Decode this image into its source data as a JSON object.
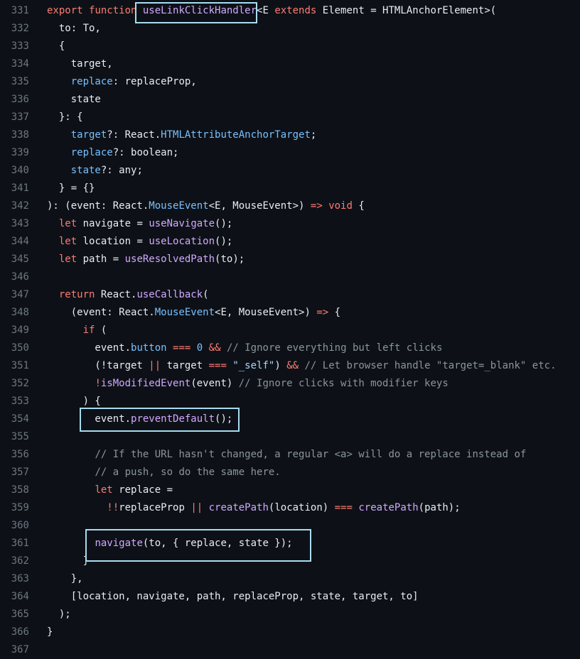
{
  "colors": {
    "background": "#0d1117",
    "keyword": "#ff7b72",
    "function": "#d2a8ff",
    "property": "#79c0ff",
    "string": "#a5d6ff",
    "comment": "#8b949e",
    "plain": "#e6edf3",
    "line_number": "#6e7681",
    "highlight_border": "#a7dcf0"
  },
  "lines": [
    {
      "n": "331",
      "tokens": [
        [
          "kw",
          "export "
        ],
        [
          "kw",
          "function "
        ],
        [
          "fn",
          "useLinkClickHandler"
        ],
        [
          "pl",
          "<E "
        ],
        [
          "kw",
          "extends "
        ],
        [
          "pl",
          "Element = HTMLAnchorElement>("
        ]
      ]
    },
    {
      "n": "332",
      "tokens": [
        [
          "pl",
          "  to: To,"
        ]
      ]
    },
    {
      "n": "333",
      "tokens": [
        [
          "pl",
          "  {"
        ]
      ]
    },
    {
      "n": "334",
      "tokens": [
        [
          "pl",
          "    target,"
        ]
      ]
    },
    {
      "n": "335",
      "tokens": [
        [
          "pl",
          "    "
        ],
        [
          "prop",
          "replace"
        ],
        [
          "pl",
          ": replaceProp,"
        ]
      ]
    },
    {
      "n": "336",
      "tokens": [
        [
          "pl",
          "    state"
        ]
      ]
    },
    {
      "n": "337",
      "tokens": [
        [
          "pl",
          "  }: {"
        ]
      ]
    },
    {
      "n": "338",
      "tokens": [
        [
          "pl",
          "    "
        ],
        [
          "prop",
          "target"
        ],
        [
          "pl",
          "?: React."
        ],
        [
          "prop",
          "HTMLAttributeAnchorTarget"
        ],
        [
          "pl",
          ";"
        ]
      ]
    },
    {
      "n": "339",
      "tokens": [
        [
          "pl",
          "    "
        ],
        [
          "prop",
          "replace"
        ],
        [
          "pl",
          "?: boolean;"
        ]
      ]
    },
    {
      "n": "340",
      "tokens": [
        [
          "pl",
          "    "
        ],
        [
          "prop",
          "state"
        ],
        [
          "pl",
          "?: any;"
        ]
      ]
    },
    {
      "n": "341",
      "tokens": [
        [
          "pl",
          "  } = {}"
        ]
      ]
    },
    {
      "n": "342",
      "tokens": [
        [
          "pl",
          "): (event: React."
        ],
        [
          "prop",
          "MouseEvent"
        ],
        [
          "pl",
          "<E, MouseEvent>) "
        ],
        [
          "op",
          "=>"
        ],
        [
          "pl",
          " "
        ],
        [
          "kw",
          "void"
        ],
        [
          "pl",
          " {"
        ]
      ]
    },
    {
      "n": "343",
      "tokens": [
        [
          "pl",
          "  "
        ],
        [
          "kw",
          "let"
        ],
        [
          "pl",
          " navigate = "
        ],
        [
          "fn",
          "useNavigate"
        ],
        [
          "pl",
          "();"
        ]
      ]
    },
    {
      "n": "344",
      "tokens": [
        [
          "pl",
          "  "
        ],
        [
          "kw",
          "let"
        ],
        [
          "pl",
          " location = "
        ],
        [
          "fn",
          "useLocation"
        ],
        [
          "pl",
          "();"
        ]
      ]
    },
    {
      "n": "345",
      "tokens": [
        [
          "pl",
          "  "
        ],
        [
          "kw",
          "let"
        ],
        [
          "pl",
          " path = "
        ],
        [
          "fn",
          "useResolvedPath"
        ],
        [
          "pl",
          "(to);"
        ]
      ]
    },
    {
      "n": "346",
      "tokens": []
    },
    {
      "n": "347",
      "tokens": [
        [
          "pl",
          "  "
        ],
        [
          "kw",
          "return"
        ],
        [
          "pl",
          " React."
        ],
        [
          "fn",
          "useCallback"
        ],
        [
          "pl",
          "("
        ]
      ]
    },
    {
      "n": "348",
      "tokens": [
        [
          "pl",
          "    (event: React."
        ],
        [
          "prop",
          "MouseEvent"
        ],
        [
          "pl",
          "<E, MouseEvent>) "
        ],
        [
          "op",
          "=>"
        ],
        [
          "pl",
          " {"
        ]
      ]
    },
    {
      "n": "349",
      "tokens": [
        [
          "pl",
          "      "
        ],
        [
          "kw",
          "if"
        ],
        [
          "pl",
          " ("
        ]
      ]
    },
    {
      "n": "350",
      "tokens": [
        [
          "pl",
          "        event."
        ],
        [
          "prop",
          "button"
        ],
        [
          "pl",
          " "
        ],
        [
          "op",
          "==="
        ],
        [
          "pl",
          " "
        ],
        [
          "num",
          "0"
        ],
        [
          "pl",
          " "
        ],
        [
          "op",
          "&&"
        ],
        [
          "pl",
          " "
        ],
        [
          "cm",
          "// Ignore everything but left clicks"
        ]
      ]
    },
    {
      "n": "351",
      "tokens": [
        [
          "pl",
          "        (!target "
        ],
        [
          "op",
          "||"
        ],
        [
          "pl",
          " target "
        ],
        [
          "op",
          "==="
        ],
        [
          "pl",
          " "
        ],
        [
          "str",
          "\"_self\""
        ],
        [
          "pl",
          ") "
        ],
        [
          "op",
          "&&"
        ],
        [
          "pl",
          " "
        ],
        [
          "cm",
          "// Let browser handle \"target=_blank\" etc."
        ]
      ]
    },
    {
      "n": "352",
      "tokens": [
        [
          "pl",
          "        "
        ],
        [
          "op",
          "!"
        ],
        [
          "fn",
          "isModifiedEvent"
        ],
        [
          "pl",
          "(event) "
        ],
        [
          "cm",
          "// Ignore clicks with modifier keys"
        ]
      ]
    },
    {
      "n": "353",
      "tokens": [
        [
          "pl",
          "      ) {"
        ]
      ]
    },
    {
      "n": "354",
      "tokens": [
        [
          "pl",
          "        event."
        ],
        [
          "fn",
          "preventDefault"
        ],
        [
          "pl",
          "();"
        ]
      ]
    },
    {
      "n": "355",
      "tokens": []
    },
    {
      "n": "356",
      "tokens": [
        [
          "pl",
          "        "
        ],
        [
          "cm",
          "// If the URL hasn't changed, a regular <a> will do a replace instead of"
        ]
      ]
    },
    {
      "n": "357",
      "tokens": [
        [
          "pl",
          "        "
        ],
        [
          "cm",
          "// a push, so do the same here."
        ]
      ]
    },
    {
      "n": "358",
      "tokens": [
        [
          "pl",
          "        "
        ],
        [
          "kw",
          "let"
        ],
        [
          "pl",
          " replace ="
        ]
      ]
    },
    {
      "n": "359",
      "tokens": [
        [
          "pl",
          "          "
        ],
        [
          "op",
          "!!"
        ],
        [
          "pl",
          "replaceProp "
        ],
        [
          "op",
          "||"
        ],
        [
          "pl",
          " "
        ],
        [
          "fn",
          "createPath"
        ],
        [
          "pl",
          "(location) "
        ],
        [
          "op",
          "==="
        ],
        [
          "pl",
          " "
        ],
        [
          "fn",
          "createPath"
        ],
        [
          "pl",
          "(path);"
        ]
      ]
    },
    {
      "n": "360",
      "tokens": []
    },
    {
      "n": "361",
      "tokens": [
        [
          "pl",
          "        "
        ],
        [
          "fn",
          "navigate"
        ],
        [
          "pl",
          "(to, { replace, state });"
        ]
      ]
    },
    {
      "n": "362",
      "tokens": [
        [
          "pl",
          "      }"
        ]
      ]
    },
    {
      "n": "363",
      "tokens": [
        [
          "pl",
          "    },"
        ]
      ]
    },
    {
      "n": "364",
      "tokens": [
        [
          "pl",
          "    [location, navigate, path, replaceProp, state, target, to]"
        ]
      ]
    },
    {
      "n": "365",
      "tokens": [
        [
          "pl",
          "  );"
        ]
      ]
    },
    {
      "n": "366",
      "tokens": [
        [
          "pl",
          "}"
        ]
      ]
    },
    {
      "n": "367",
      "tokens": []
    }
  ]
}
